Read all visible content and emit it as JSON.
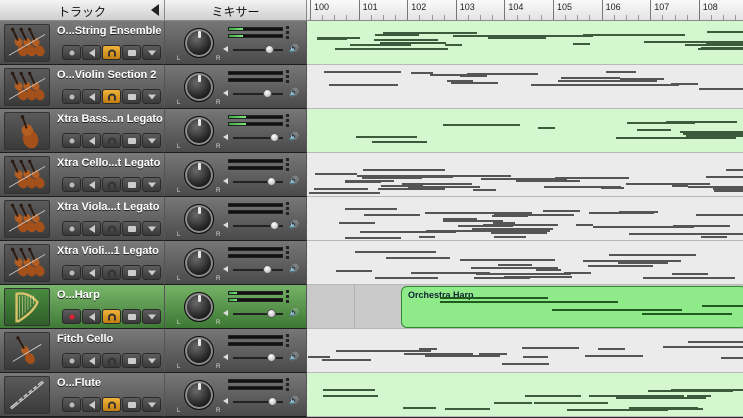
{
  "header": {
    "tracks_label": "トラック",
    "mixer_label": "ミキサー",
    "ruler": [
      "100",
      "101",
      "102",
      "103",
      "104",
      "105",
      "106",
      "107",
      "108"
    ]
  },
  "tracks": [
    {
      "name": "O...String Ensemble",
      "icon": "strings-icon",
      "lane": "green",
      "meter": 0.25,
      "volume": 0.75,
      "listen_on": true,
      "selected": false
    },
    {
      "name": "O...Violin Section 2",
      "icon": "strings-icon",
      "lane": "white",
      "meter": 0.0,
      "volume": 0.7,
      "listen_on": true,
      "selected": false
    },
    {
      "name": "Xtra Bass...n Legato",
      "icon": "double-bass-icon",
      "lane": "green",
      "meter": 0.3,
      "volume": 0.85,
      "listen_on": false,
      "selected": false
    },
    {
      "name": "Xtra Cello...t Legato",
      "icon": "strings-icon",
      "lane": "white",
      "meter": 0.0,
      "volume": 0.8,
      "listen_on": false,
      "selected": false
    },
    {
      "name": "Xtra Viola...t Legato",
      "icon": "strings-icon",
      "lane": "white",
      "meter": 0.0,
      "volume": 0.85,
      "listen_on": false,
      "selected": false
    },
    {
      "name": "Xtra Violi...1 Legato",
      "icon": "strings-icon",
      "lane": "white",
      "meter": 0.0,
      "volume": 0.7,
      "listen_on": false,
      "selected": false
    },
    {
      "name": "O...Harp",
      "icon": "harp-icon",
      "lane": "gray",
      "meter": 0.15,
      "volume": 0.8,
      "listen_on": true,
      "selected": true,
      "region": "Orchestra Harp"
    },
    {
      "name": "Fitch Cello",
      "icon": "cello-icon",
      "lane": "white",
      "meter": 0.0,
      "volume": 0.8,
      "listen_on": false,
      "selected": false
    },
    {
      "name": "O...Flute",
      "icon": "flute-icon",
      "lane": "green",
      "meter": 0.0,
      "volume": 0.82,
      "listen_on": true,
      "selected": false
    }
  ],
  "colors": {
    "selected_track": "#4f9445",
    "green_lane": "#d4f7d0",
    "region": "#8fea8a",
    "listen_on": "#f0b33a"
  }
}
